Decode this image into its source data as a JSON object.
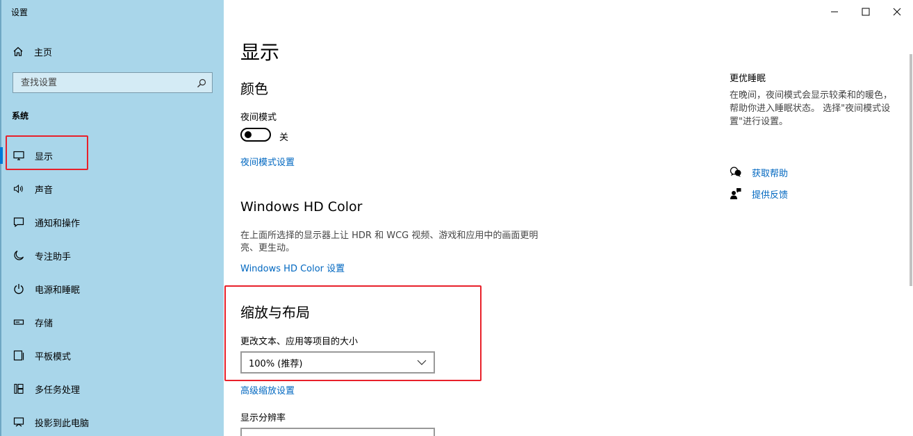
{
  "window": {
    "title": "设置",
    "controls": [
      "minimize",
      "maximize",
      "close"
    ]
  },
  "sidebar": {
    "home_label": "主页",
    "search_placeholder": "查找设置",
    "section_label": "系统",
    "items": [
      {
        "label": "显示",
        "icon": "monitor-icon",
        "active": true
      },
      {
        "label": "声音",
        "icon": "speaker-icon"
      },
      {
        "label": "通知和操作",
        "icon": "message-icon"
      },
      {
        "label": "专注助手",
        "icon": "moon-icon"
      },
      {
        "label": "电源和睡眠",
        "icon": "power-icon"
      },
      {
        "label": "存储",
        "icon": "storage-icon"
      },
      {
        "label": "平板模式",
        "icon": "tablet-icon"
      },
      {
        "label": "多任务处理",
        "icon": "multitask-icon"
      },
      {
        "label": "投影到此电脑",
        "icon": "project-icon"
      }
    ]
  },
  "main": {
    "title": "显示",
    "color_section": {
      "heading": "颜色",
      "night_mode_label": "夜间模式",
      "night_mode_state": "关",
      "night_mode_settings_link": "夜间模式设置"
    },
    "hdr_section": {
      "heading": "Windows HD Color",
      "description": "在上面所选择的显示器上让 HDR 和 WCG 视频、游戏和应用中的画面更明亮、更生动。",
      "settings_link": "Windows HD Color 设置"
    },
    "scale_section": {
      "heading": "缩放与布局",
      "text_size_label": "更改文本、应用等项目的大小",
      "text_size_value": "100% (推荐)",
      "advanced_link": "高级缩放设置",
      "resolution_label": "显示分辨率"
    }
  },
  "right_panel": {
    "title": "更优睡眠",
    "description": "在晚间，夜间模式会显示较柔和的暖色，帮助你进入睡眠状态。 选择\"夜间模式设置\"进行设置。",
    "help_link": "获取帮助",
    "feedback_link": "提供反馈"
  },
  "annotations": {
    "highlight_color": "#e8202a"
  },
  "colors": {
    "sidebar_bg": "#a9d6ea",
    "link": "#0067c0",
    "accent": "#0078d7"
  }
}
